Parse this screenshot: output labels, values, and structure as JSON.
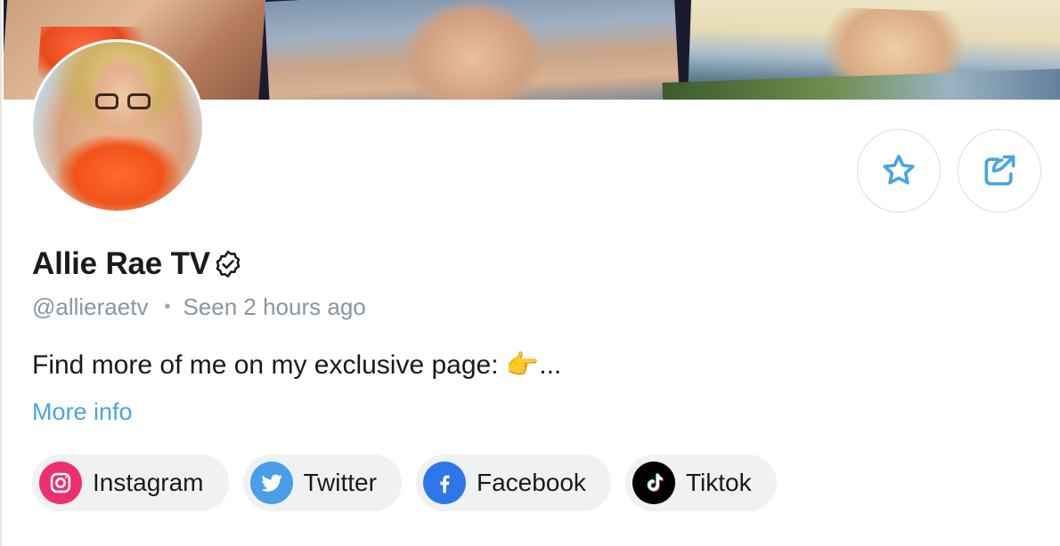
{
  "profile": {
    "display_name": "Allie Rae TV",
    "handle": "@allieraetv",
    "last_seen": "Seen 2 hours ago",
    "bio": "Find more of me on my exclusive page: 👉...",
    "more_info_label": "More info",
    "verified": true
  },
  "actions": {
    "favorite_icon": "star-icon",
    "share_icon": "share-icon"
  },
  "socials": [
    {
      "label": "Instagram",
      "icon": "instagram-icon",
      "color": "#ed2f6f"
    },
    {
      "label": "Twitter",
      "icon": "twitter-icon",
      "color": "#4a9ee8"
    },
    {
      "label": "Facebook",
      "icon": "facebook-icon",
      "color": "#2f77e8"
    },
    {
      "label": "Tiktok",
      "icon": "tiktok-icon",
      "color": "#000000"
    }
  ],
  "colors": {
    "accent": "#4aa4e3",
    "muted_text": "#8a96a3",
    "chip_bg": "#eff1f3"
  }
}
